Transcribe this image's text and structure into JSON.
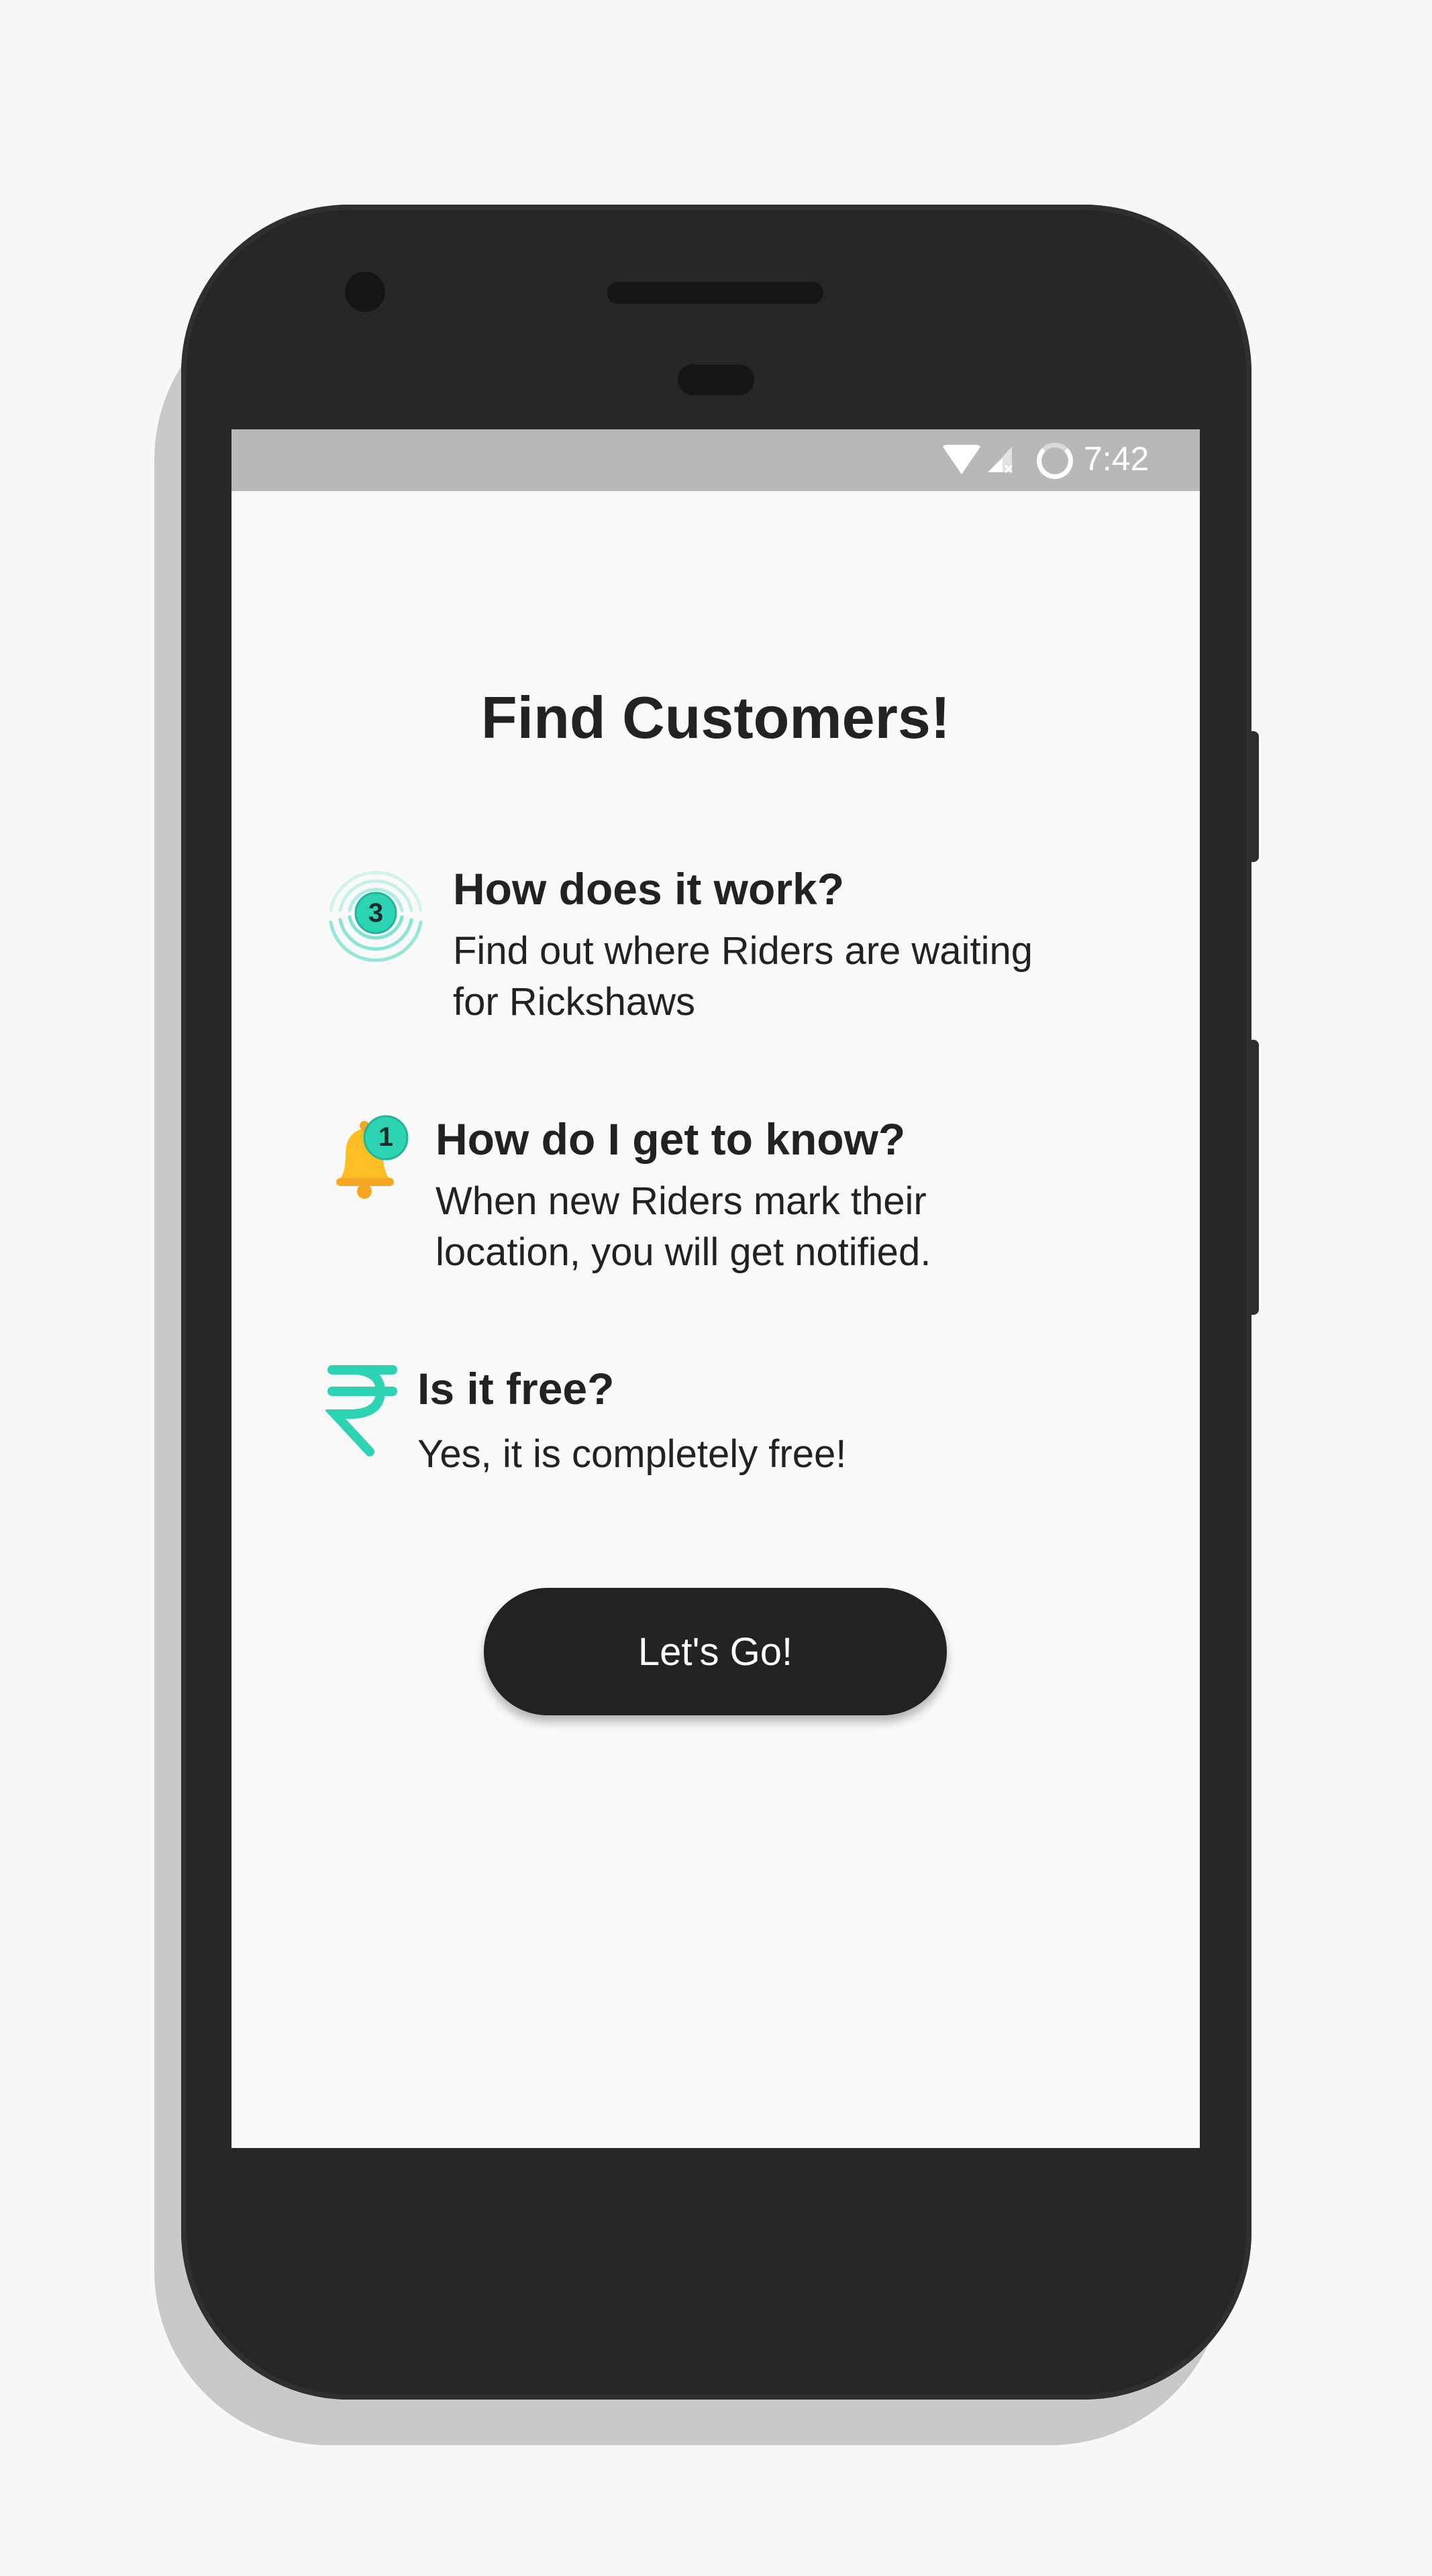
{
  "status_bar": {
    "time": "7:42",
    "icons": [
      "wifi-icon",
      "signal-icon",
      "sync-icon"
    ]
  },
  "onboarding": {
    "title": "Find Customers!",
    "features": [
      {
        "icon": "rider-signal-icon",
        "badge": "3",
        "heading": "How does it work?",
        "description_lines": [
          "Find out where Riders are waiting",
          "for Rickshaws"
        ]
      },
      {
        "icon": "notification-bell-icon",
        "badge": "1",
        "heading": "How do I get to know?",
        "description_lines": [
          "When new Riders mark their",
          "location, you will get notified."
        ]
      },
      {
        "icon": "rupee-icon",
        "heading": "Is it free?",
        "description_lines": [
          "Yes, it is completely free!"
        ]
      }
    ],
    "button_label": "Let's Go!"
  },
  "colors": {
    "accent_teal": "#2dd4b3",
    "bell_yellow": "#fbbf24",
    "text_dark": "#222222",
    "button_bg": "#222222",
    "screen_bg": "#fafafa",
    "status_bar_bg": "#b8b8b8",
    "phone_body": "#262626"
  }
}
